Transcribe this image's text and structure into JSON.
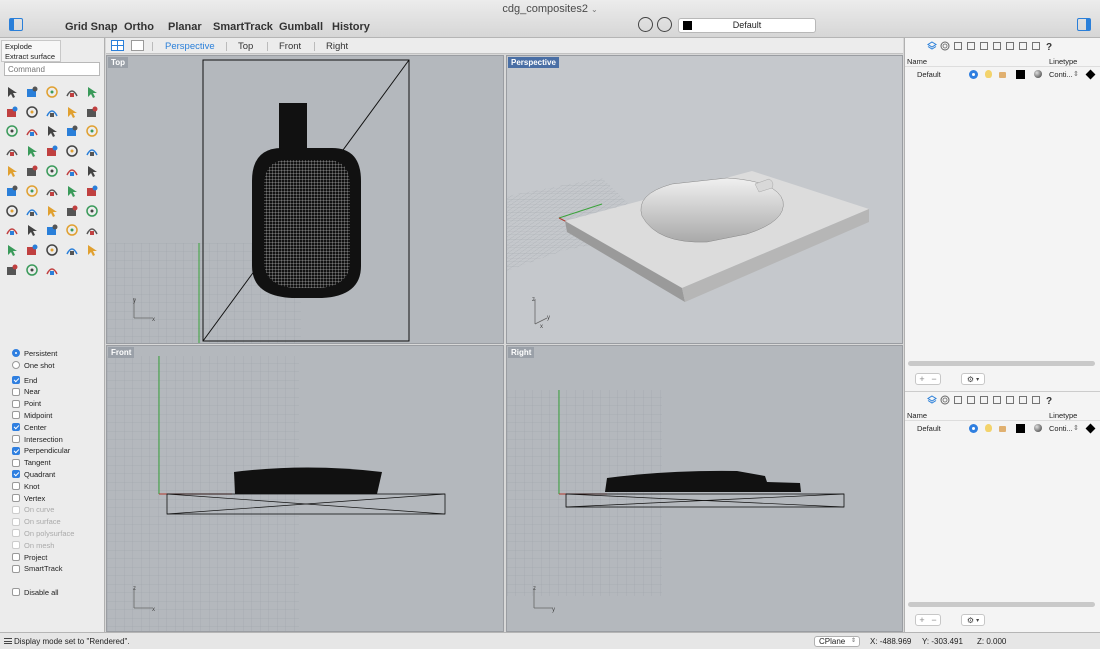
{
  "window": {
    "title": "cdg_composites2"
  },
  "toolbar": {
    "modes": [
      "Grid Snap",
      "Ortho",
      "Planar",
      "SmartTrack",
      "Gumball",
      "History"
    ],
    "display_mode": "Default"
  },
  "left_panel": {
    "tooltip": [
      "Explode",
      "Extract surface"
    ],
    "command_placeholder": "Command",
    "tools": [
      "select-arrow",
      "point",
      "polyline",
      "curve",
      "circle",
      "ellipse",
      "line-curve",
      "spline",
      "offset",
      "arc",
      "surface",
      "fillet",
      "box",
      "sphere",
      "cylinder",
      "extrude",
      "group",
      "flow",
      "trim",
      "split",
      "boolean",
      "move",
      "rotate",
      "scale",
      "dimension",
      "array",
      "block",
      "mesh",
      "check",
      "analyze",
      "render",
      "zoom",
      "pan",
      "rotate-view",
      "light",
      "history",
      "car",
      "hatch",
      "viewport",
      "help",
      "lock",
      "paint",
      "color-wheel",
      "globe",
      "gear",
      "sphere-blue",
      "cursor-select",
      "properties"
    ],
    "snap_mode": [
      {
        "label": "Persistent",
        "selected": true
      },
      {
        "label": "One shot",
        "selected": false
      }
    ],
    "osnaps": [
      {
        "label": "End",
        "checked": true,
        "enabled": true
      },
      {
        "label": "Near",
        "checked": false,
        "enabled": true
      },
      {
        "label": "Point",
        "checked": false,
        "enabled": true
      },
      {
        "label": "Midpoint",
        "checked": false,
        "enabled": true
      },
      {
        "label": "Center",
        "checked": true,
        "enabled": true
      },
      {
        "label": "Intersection",
        "checked": false,
        "enabled": true
      },
      {
        "label": "Perpendicular",
        "checked": true,
        "enabled": true
      },
      {
        "label": "Tangent",
        "checked": false,
        "enabled": true
      },
      {
        "label": "Quadrant",
        "checked": true,
        "enabled": true
      },
      {
        "label": "Knot",
        "checked": false,
        "enabled": true
      },
      {
        "label": "Vertex",
        "checked": false,
        "enabled": true
      },
      {
        "label": "On curve",
        "checked": false,
        "enabled": false
      },
      {
        "label": "On surface",
        "checked": false,
        "enabled": false
      },
      {
        "label": "On polysurface",
        "checked": false,
        "enabled": false
      },
      {
        "label": "On mesh",
        "checked": false,
        "enabled": false
      },
      {
        "label": "Project",
        "checked": false,
        "enabled": true
      },
      {
        "label": "SmartTrack",
        "checked": false,
        "enabled": true
      }
    ],
    "disable_all": "Disable all"
  },
  "viewport_tabs": [
    "Perspective",
    "Top",
    "Front",
    "Right"
  ],
  "active_viewport_tab": "Perspective",
  "viewports": [
    {
      "id": "top",
      "title": "Top",
      "active": false
    },
    {
      "id": "perspective",
      "title": "Perspective",
      "active": true
    },
    {
      "id": "front",
      "title": "Front",
      "active": false
    },
    {
      "id": "right",
      "title": "Right",
      "active": false
    }
  ],
  "axes": {
    "x": "x",
    "y": "y",
    "z": "z"
  },
  "layers_panels": [
    {
      "col_name": "Name",
      "col_linetype": "Linetype",
      "layer": "Default",
      "linetype": "Conti...",
      "color": "#000000"
    },
    {
      "col_name": "Name",
      "col_linetype": "Linetype",
      "layer": "Default",
      "linetype": "Conti...",
      "color": "#000000"
    }
  ],
  "panel_icons": [
    "layers-icon",
    "materials-icon",
    "document-icon",
    "cube-icon",
    "camera-icon",
    "cloud-icon",
    "document-icon",
    "display-icon",
    "monitor-icon",
    "help-icon"
  ],
  "status": {
    "message": "Display mode set to \"Rendered\".",
    "cplane": "CPlane",
    "x": "X: -488.969",
    "y": "Y: -303.491",
    "z": "Z: 0.000"
  },
  "colors": {
    "accent": "#2a7fd9",
    "viewport_bg": "#b4b8bd",
    "x_axis": "#b03a2e",
    "y_axis": "#3aa33a"
  }
}
